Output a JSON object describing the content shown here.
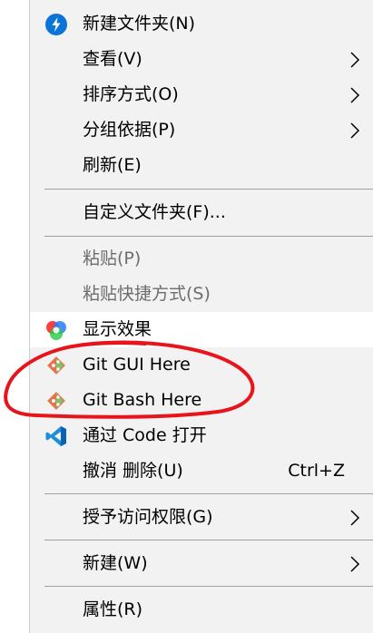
{
  "menu": {
    "items": [
      {
        "label": "新建文件夹(N)",
        "icon": "new-folder-icon"
      },
      {
        "label": "查看(V)",
        "submenu": true
      },
      {
        "label": "排序方式(O)",
        "submenu": true
      },
      {
        "label": "分组依据(P)",
        "submenu": true
      },
      {
        "label": "刷新(E)"
      },
      {
        "label": "自定义文件夹(F)..."
      },
      {
        "label": "粘贴(P)",
        "disabled": true
      },
      {
        "label": "粘贴快捷方式(S)",
        "disabled": true
      },
      {
        "label": "显示效果",
        "icon": "color-wheel-icon"
      },
      {
        "label": "Git GUI Here",
        "icon": "git-icon"
      },
      {
        "label": "Git Bash Here",
        "icon": "git-icon"
      },
      {
        "label": "通过 Code 打开",
        "icon": "vscode-icon"
      },
      {
        "label": "撤消 删除(U)",
        "shortcut": "Ctrl+Z"
      },
      {
        "label": "授予访问权限(G)",
        "submenu": true
      },
      {
        "label": "新建(W)",
        "submenu": true
      },
      {
        "label": "属性(R)"
      }
    ]
  },
  "colors": {
    "menu_background": "#f2f2f2",
    "hover_background": "#ffffff",
    "disabled_text": "#6d6d6d",
    "annotation": "#e8141c",
    "new_folder_icon": "#0a74d9",
    "vscode_icon": "#1e8fd6"
  }
}
